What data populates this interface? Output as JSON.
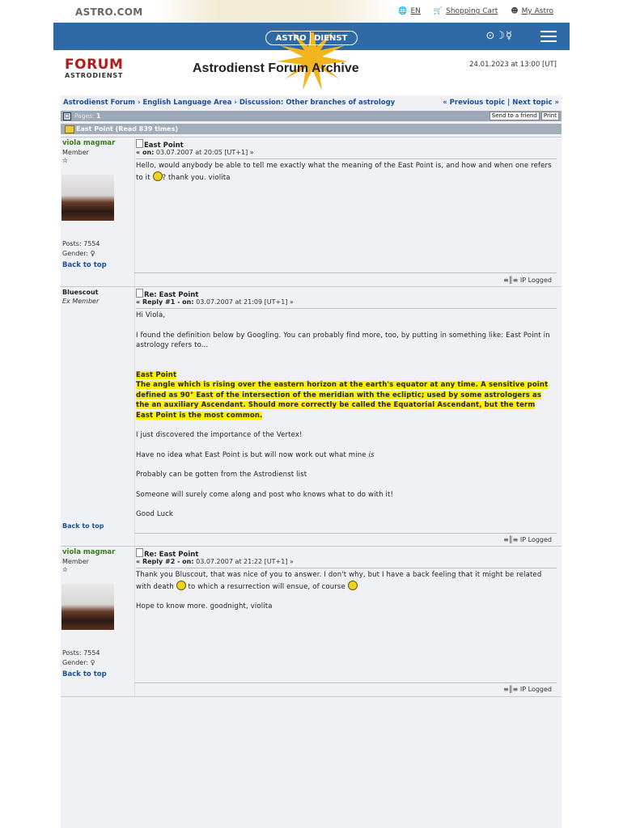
{
  "site": {
    "logo": "ASTRO.COM",
    "links": [
      {
        "label": "EN"
      },
      {
        "label": "Shopping Cart"
      },
      {
        "label": "My Astro"
      }
    ],
    "brand_left": "ASTRO",
    "brand_right": "DIENST",
    "symbols": "⊙☽☿"
  },
  "header": {
    "forum_logo_main": "FORUM",
    "forum_logo_sub": "ASTRODIENST",
    "title": "Astrodienst Forum Archive",
    "date": "24.01.2023 at 13:00 [UT]"
  },
  "nav": {
    "breadcrumb": "Astrodienst Forum › English Language Area › Discussion: Other branches of astrology",
    "prev": "« Previous topic",
    "sep": "|",
    "next": "Next topic »",
    "pages_label": "Pages:",
    "pages_value": "1",
    "send_label": "Send to a friend",
    "print_label": "Print"
  },
  "topic": {
    "title": "East Point (Read 839 times)"
  },
  "posts": [
    {
      "author": "viola magmar",
      "role": "Member",
      "stars": "✫",
      "posts": "Posts: 7554",
      "gender": "Gender: ♀",
      "back_to_top": "Back to top",
      "subject": "East Point",
      "meta_prefix": "« on:",
      "meta_date": "03.07.2007 at 20:05 [UT+1] »",
      "body_a": "Hello, would anybody be able to tell me exactly what the meaning of the East Point is, and how and when one refers to it",
      "body_b": "? thank you. violita",
      "ip_logged": "IP Logged"
    },
    {
      "author": "Bluescout",
      "role": "Ex Member",
      "back_to_top": "Back to top",
      "subject": "Re: East Point",
      "meta_prefix": "« Reply #1 - on:",
      "meta_date": "03.07.2007 at 21:09 [UT+1] »",
      "p1": "Hi Viola,",
      "p2": "I found the definition below by Googling. You can probably find more, too, by putting in something like: East Point in astrology refers to...",
      "hl_title": "East Point",
      "hl_body": "The angle which is rising over the eastern horizon at the earth's equator at any time. A sensitive point defined as 90° East of the intersection of the meridian with the ecliptic; used by some astrologers as the an auxiliary Ascendant. Should more correctly be called the Equatorial Ascendant, but the term East Point is the most common.",
      "p3": "I just  discovered the importance of the Vertex!",
      "p4a": "Have no idea what East Point is but will now work out what mine",
      "p4b": "is",
      "p5": "Probably can be gotten from the Astrodienst list",
      "p6": "Someone will surely come along and post who knows what to do with it!",
      "p7": "Good Luck",
      "ip_logged": "IP Logged"
    },
    {
      "author": "viola magmar",
      "role": "Member",
      "stars": "✫",
      "posts": "Posts: 7554",
      "gender": "Gender: ♀",
      "back_to_top": "Back to top",
      "subject": "Re: East Point",
      "meta_prefix": "« Reply #2 - on:",
      "meta_date": "03.07.2007 at 21:22 [UT+1] »",
      "body_a": "Thank you  Bluscout, that was nice of you to answer. I don't why, but I have a  back feeling that it might be related with death",
      "body_b": "to which a resurrection will ensue, of course",
      "p2": "Hope to know more. goodnight, violita",
      "ip_logged": "IP Logged"
    }
  ]
}
